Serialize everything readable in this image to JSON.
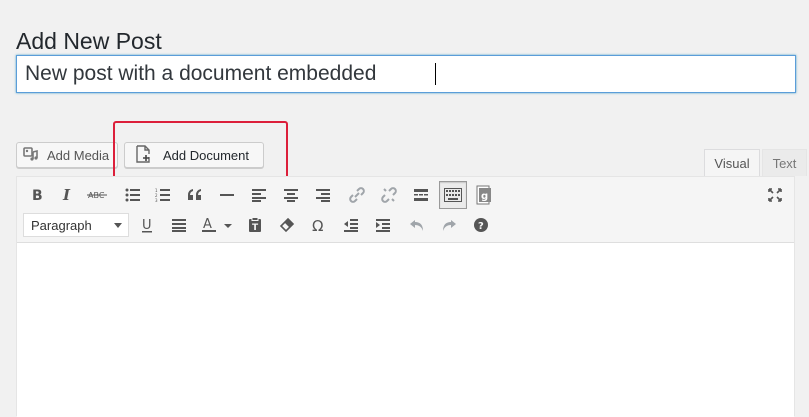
{
  "page": {
    "title": "Add New Post"
  },
  "post": {
    "title_value": "New post with a document embedded"
  },
  "media_buttons": {
    "add_media": "Add Media",
    "add_document": "Add Document"
  },
  "editor_tabs": {
    "visual": "Visual",
    "text": "Text",
    "active": "Visual"
  },
  "toolbar": {
    "format_select": {
      "selected": "Paragraph"
    },
    "row1_icons": [
      "bold-icon",
      "italic-icon",
      "strikethrough-icon",
      "bullet-list-icon",
      "numbered-list-icon",
      "blockquote-icon",
      "horizontal-rule-icon",
      "align-left-icon",
      "align-center-icon",
      "align-right-icon",
      "link-icon",
      "unlink-icon",
      "read-more-icon",
      "toolbar-toggle-icon",
      "google-docs-icon",
      "fullscreen-icon"
    ],
    "row2_icons": [
      "underline-icon",
      "justify-icon",
      "text-color-icon",
      "paste-as-text-icon",
      "clear-formatting-icon",
      "special-character-icon",
      "outdent-icon",
      "indent-icon",
      "undo-icon",
      "redo-icon",
      "help-icon"
    ]
  },
  "colors": {
    "highlight_border": "#dc1f3a",
    "focus_border": "#5b9dd9",
    "background": "#f1f1f1"
  }
}
